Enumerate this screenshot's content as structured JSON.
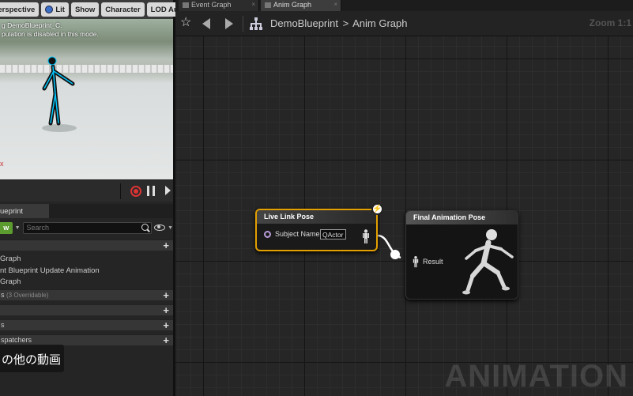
{
  "viewport": {
    "toolbar": {
      "perspective_label": "Perspective",
      "lit_label": "Lit",
      "show_label": "Show",
      "character_label": "Character",
      "lod_label": "LOD Auto"
    },
    "messages": [
      "g DemoBlueprint_C.",
      "pulation is disabled in this mode."
    ]
  },
  "my_blueprint": {
    "tab_label": "ueprint",
    "add_label": "w",
    "search_placeholder": "Search",
    "tree_items": [
      "Graph",
      "nt Blueprint Update Animation",
      "Graph"
    ],
    "sections": [
      {
        "label": "s",
        "sub": "(3 Overridable)"
      },
      {
        "label": "",
        "sub": ""
      },
      {
        "label": "s",
        "sub": ""
      },
      {
        "label": "spatchers",
        "sub": ""
      }
    ]
  },
  "subtitle": "の他の動画",
  "editor": {
    "tabs": [
      {
        "label": "Event Graph",
        "active": false
      },
      {
        "label": "Anim Graph",
        "active": true
      }
    ],
    "breadcrumb": {
      "root": "DemoBlueprint",
      "separator": ">",
      "current": "Anim Graph"
    },
    "zoom_label": "Zoom 1:1"
  },
  "nodes": {
    "live_link_pose": {
      "title": "Live Link Pose",
      "pin_label": "Subject Name",
      "subject_value": "QActor",
      "badge": "⚡"
    },
    "final_animation_pose": {
      "title": "Final Animation Pose",
      "pin_label": "Result"
    }
  },
  "watermark": "ANIMATION",
  "colors": {
    "selected_node_border": "#e3a000",
    "subject_pin": "#b59bd8",
    "add_button": "#5c9b2e",
    "character_highlight": "#00c8ff"
  }
}
